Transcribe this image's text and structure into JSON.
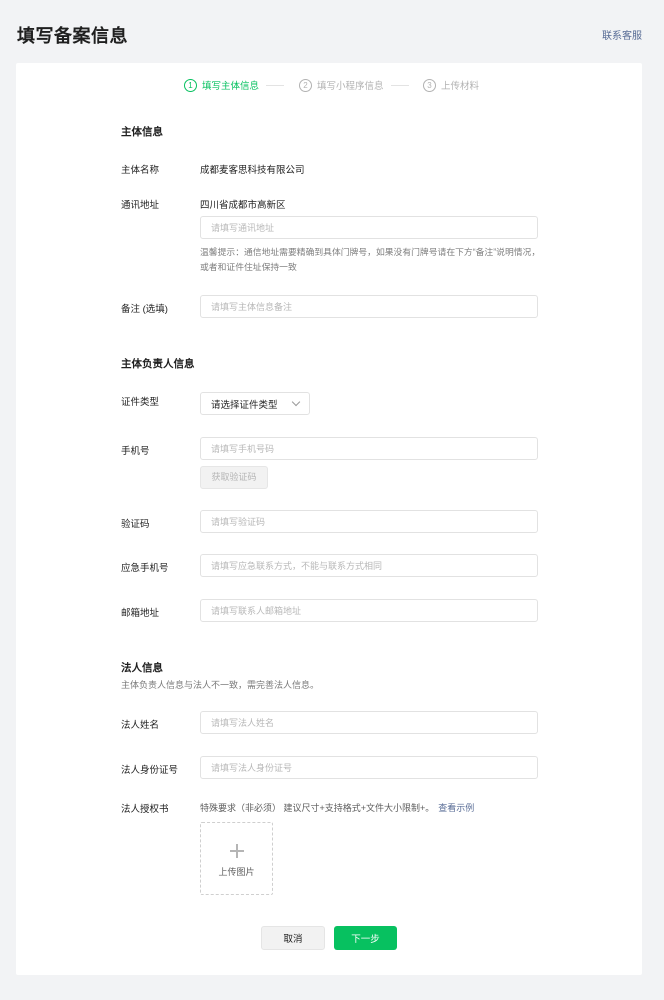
{
  "header": {
    "title": "填写备案信息",
    "contact_label": "联系客服"
  },
  "steps": [
    {
      "num": "1",
      "label": "填写主体信息",
      "active": true
    },
    {
      "num": "2",
      "label": "填写小程序信息",
      "active": false
    },
    {
      "num": "3",
      "label": "上传材料",
      "active": false
    }
  ],
  "subject": {
    "section_title": "主体信息",
    "name_label": "主体名称",
    "name_value": "成都麦客思科技有限公司",
    "address_label": "通讯地址",
    "address_value": "四川省成都市高新区",
    "address_placeholder": "请填写通讯地址",
    "address_hint": "温馨提示：通信地址需要精确到具体门牌号，如果没有门牌号请在下方“备注”说明情况，或者和证件住址保持一致",
    "remark_label": "备注 (选填)",
    "remark_placeholder": "请填写主体信息备注"
  },
  "principal": {
    "section_title": "主体负责人信息",
    "id_type_label": "证件类型",
    "id_type_value": "请选择证件类型",
    "phone_label": "手机号",
    "phone_placeholder": "请填写手机号码",
    "get_code_label": "获取验证码",
    "code_label": "验证码",
    "code_placeholder": "请填写验证码",
    "emergency_label": "应急手机号",
    "emergency_placeholder": "请填写应急联系方式，不能与联系方式相同",
    "email_label": "邮箱地址",
    "email_placeholder": "请填写联系人邮箱地址"
  },
  "legal": {
    "section_title": "法人信息",
    "section_desc": "主体负责人信息与法人不一致，需完善法人信息。",
    "name_label": "法人姓名",
    "name_placeholder": "请填写法人姓名",
    "id_label": "法人身份证号",
    "id_placeholder": "请填写法人身份证号",
    "auth_label": "法人授权书",
    "auth_hint": "特殊要求（非必须） 建议尺寸+支持格式+文件大小限制+。",
    "auth_example_link": "查看示例",
    "upload_label": "上传图片"
  },
  "footer": {
    "cancel_label": "取消",
    "next_label": "下一步"
  },
  "colors": {
    "accent": "#07c160",
    "link": "#576b95",
    "background": "#f2f3f5"
  }
}
